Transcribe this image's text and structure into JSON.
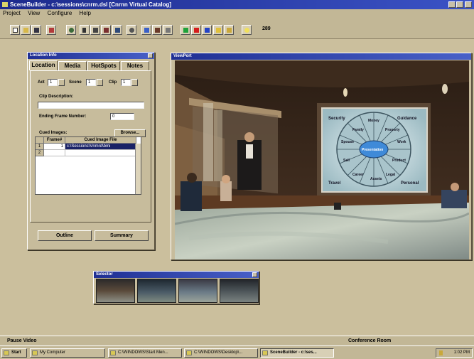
{
  "app": {
    "title": "SceneBuilder - c:\\sessions\\cnrm.dsl  [Cnrnn Virtual Catalog]"
  },
  "menu": [
    "Project",
    "View",
    "Configure",
    "Help"
  ],
  "toolbar": {
    "buttons": [
      "new-icon",
      "open-icon",
      "save-icon",
      "print-icon",
      "globe-icon",
      "pointer-icon",
      "graph-icon",
      "layout-icon",
      "camera-icon",
      "check-icon",
      "tools-icon",
      "build-icon",
      "play-icon",
      "stop-icon",
      "pause-icon",
      "folders-icon",
      "image-icon",
      "light-icon"
    ],
    "status_text": "289"
  },
  "location_info": {
    "title": "Location Info",
    "tabs": [
      "Location",
      "Media",
      "HotSpots",
      "Notes"
    ],
    "act_label": "Act",
    "act_value": "1",
    "scene_label": "Scene",
    "scene_value": "1",
    "clip_label": "Clip",
    "clip_value": "1",
    "clip_description_label": "Clip Description:",
    "clip_description_value": "",
    "ending_frame_label": "Ending Frame Number:",
    "ending_frame_value": "0",
    "cued_images_label": "Cued Images:",
    "browse_label": "Browse...",
    "grid_headers": [
      "Frame#",
      "Cued Image File"
    ],
    "grid_rows": [
      {
        "num": "1",
        "frame": "1",
        "file": "c:\\Sessions\\Vnmrd\\bmi"
      },
      {
        "num": "2",
        "frame": "",
        "file": ""
      }
    ],
    "outline_label": "Outline",
    "summary_label": "Summary"
  },
  "viewport": {
    "title": "ViewPort",
    "wheel_labels": [
      "Security",
      "Guidance",
      "Family",
      "Money",
      "Property",
      "Spouse",
      "Work",
      "Presentation",
      "Sell",
      "Product",
      "Career",
      "Assets",
      "Legal",
      "Travel",
      "Personal"
    ]
  },
  "selector": {
    "title": "Selector",
    "thumb_count": 4
  },
  "statusbar": {
    "left": "Pause Video",
    "right": "Conference Room"
  },
  "taskbar": {
    "start": "Start",
    "tasks": [
      "My Computer",
      "C:\\WINDOWS\\Start Men...",
      "C:\\WINDOWS\\Desktop\\...",
      "SceneBuilder - c:\\ses..."
    ],
    "clock": "1:02 PM"
  },
  "colors": {
    "desktop": "#cbbf9d",
    "titlebar": "#1c2a8c",
    "scene_wall": "#3a2a1c",
    "table_teal": "#7fa9ad"
  }
}
